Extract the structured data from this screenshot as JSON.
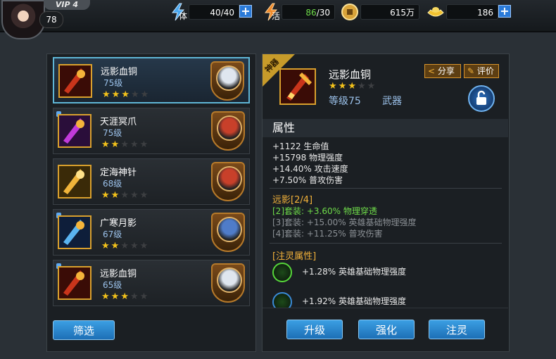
{
  "player": {
    "vip": "VIP 4",
    "level": "78"
  },
  "resources": {
    "stamina": {
      "label": "体",
      "current": "40",
      "max": "/40"
    },
    "energy": {
      "label": "活",
      "current": "86",
      "max": "/30"
    },
    "coins": {
      "value": "615万"
    },
    "ingots": {
      "value": "186"
    }
  },
  "list": [
    {
      "name": "远影血铜",
      "level": "75级",
      "stars": 3,
      "selected": true,
      "locked": false
    },
    {
      "name": "天涯冥爪",
      "level": "75级",
      "stars": 2,
      "selected": false,
      "locked": true
    },
    {
      "name": "定海神针",
      "level": "68级",
      "stars": 2,
      "selected": false,
      "locked": false
    },
    {
      "name": "广寒月影",
      "level": "67级",
      "stars": 2,
      "selected": false,
      "locked": true
    },
    {
      "name": "远影血铜",
      "level": "65级",
      "stars": 3,
      "selected": false,
      "locked": true
    }
  ],
  "filter_label": "筛选",
  "detail": {
    "ribbon": "神器",
    "name": "远影血铜",
    "stars": 3,
    "level": "等级75",
    "type": "武器",
    "share": "分享",
    "review": "评价",
    "attr_title": "属性",
    "attrs": [
      "+1122 生命值",
      "+15798 物理强度",
      "+14.40% 攻击速度",
      "+7.50% 普攻伤害"
    ],
    "set_title": "远影[2/4]",
    "set_lines": [
      {
        "text": "[2]套装: +3.60% 物理穿透",
        "active": true
      },
      {
        "text": "[3]套装: +15.00% 英雄基础物理强度",
        "active": false
      },
      {
        "text": "[4]套装: +11.25% 普攻伤害",
        "active": false
      }
    ],
    "spirit_title": "[注灵属性]",
    "spirit_lines": [
      "+1.28% 英雄基础物理强度",
      "+1.92% 英雄基础物理强度"
    ]
  },
  "actions": {
    "upgrade": "升级",
    "enhance": "强化",
    "infuse": "注灵"
  },
  "colors": {
    "accent": "#2a7ad8",
    "gold_star": "#f3c21b",
    "set_active": "#6fdc4a",
    "set_inactive": "#8a8f94"
  }
}
